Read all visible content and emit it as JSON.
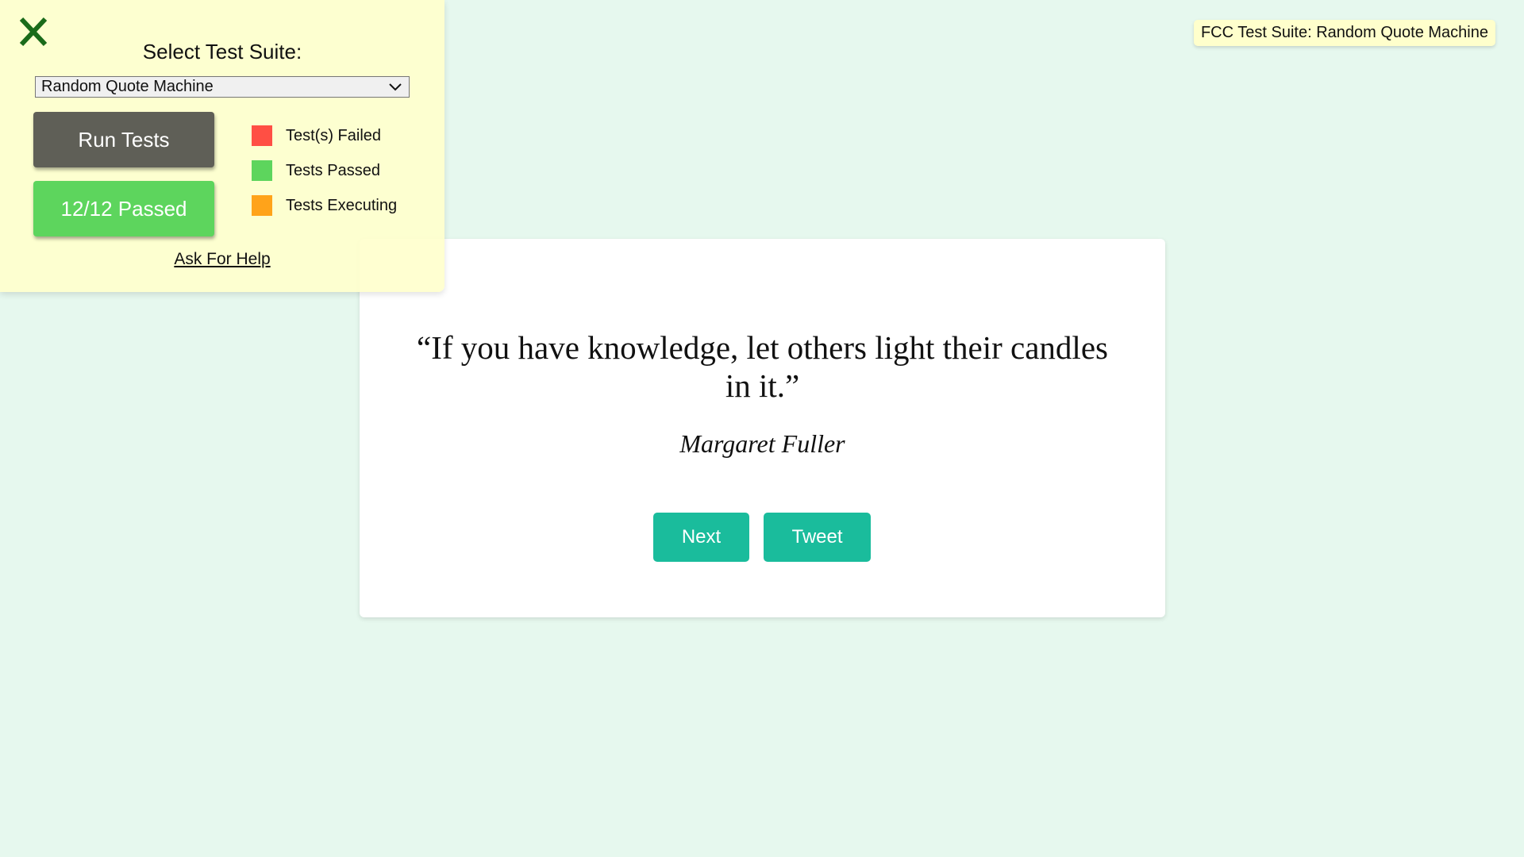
{
  "quote_box": {
    "text": "“If you have knowledge, let others light their candles in it.”",
    "author": "Margaret Fuller",
    "next_label": "Next",
    "tweet_label": "Tweet"
  },
  "test_panel": {
    "close_icon": "close-x-icon",
    "title": "Select Test Suite:",
    "selected_suite": "Random Quote Machine",
    "run_label": "Run Tests",
    "result_label": "12/12 Passed",
    "help_label": "Ask For Help",
    "legend": [
      {
        "label": "Test(s) Failed",
        "color": "#ff4f44"
      },
      {
        "label": "Tests Passed",
        "color": "#5dd55d"
      },
      {
        "label": "Tests Executing",
        "color": "#ffa31a"
      }
    ]
  },
  "badge": {
    "label": "FCC Test Suite: Random Quote Machine"
  },
  "colors": {
    "background": "#e6f8ee",
    "accent": "#1abc9c",
    "panel": "#ffffcc"
  }
}
